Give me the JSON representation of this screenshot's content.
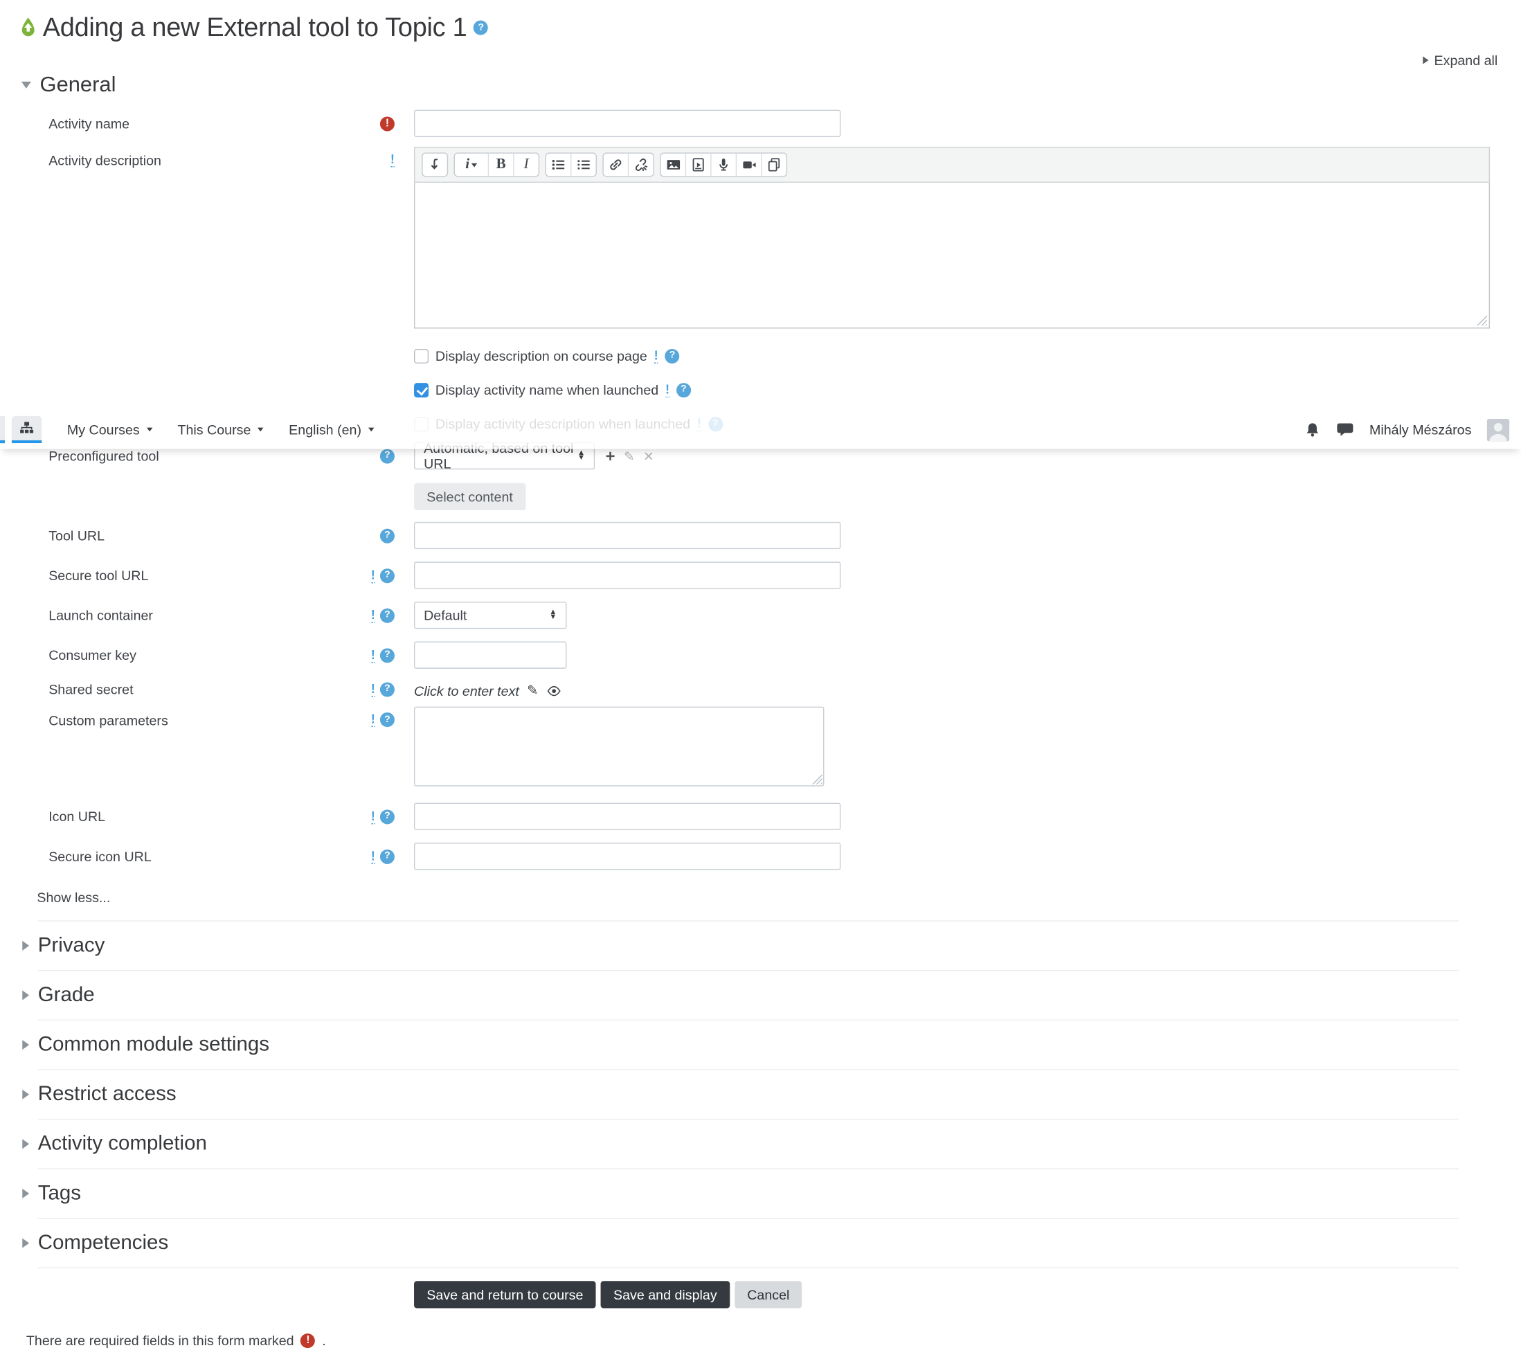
{
  "page": {
    "title": "Adding a new External tool to Topic 1",
    "expand_all": "Expand all",
    "show_less": "Show less...",
    "required_note": "There are required fields in this form marked",
    "required_note_suffix": "."
  },
  "navbar": {
    "items": [
      {
        "label": "My Courses"
      },
      {
        "label": "This Course"
      },
      {
        "label": "English (en)"
      }
    ],
    "user": {
      "name": "Mihály Mészáros"
    },
    "icons": [
      "sitemap-icon",
      "bell-icon",
      "chat-icon",
      "avatar"
    ]
  },
  "sections": {
    "general": "General",
    "collapsed": [
      {
        "label": "Privacy"
      },
      {
        "label": "Grade"
      },
      {
        "label": "Common module settings"
      },
      {
        "label": "Restrict access"
      },
      {
        "label": "Activity completion"
      },
      {
        "label": "Tags"
      },
      {
        "label": "Competencies"
      }
    ]
  },
  "fields": {
    "activity_name": {
      "label": "Activity name",
      "value": "",
      "required": true
    },
    "activity_description": {
      "label": "Activity description",
      "value": ""
    },
    "display_description": {
      "label": "Display description on course page",
      "checked": false
    },
    "display_name_launch": {
      "label": "Display activity name when launched",
      "checked": true
    },
    "display_desc_launch": {
      "label": "Display activity description when launched",
      "checked": false
    },
    "preconfigured_tool": {
      "label": "Preconfigured tool",
      "value": "Automatic, based on tool URL"
    },
    "select_content": {
      "label": "Select content"
    },
    "tool_url": {
      "label": "Tool URL",
      "value": ""
    },
    "secure_tool_url": {
      "label": "Secure tool URL",
      "value": ""
    },
    "launch_container": {
      "label": "Launch container",
      "value": "Default"
    },
    "consumer_key": {
      "label": "Consumer key",
      "value": ""
    },
    "shared_secret": {
      "label": "Shared secret",
      "placeholder": "Click to enter text"
    },
    "custom_parameters": {
      "label": "Custom parameters",
      "value": ""
    },
    "icon_url": {
      "label": "Icon URL",
      "value": ""
    },
    "secure_icon_url": {
      "label": "Secure icon URL",
      "value": ""
    }
  },
  "editor_toolbar": {
    "icons": [
      "collapse-toolbar-icon",
      "paragraph-styles-icon",
      "bold-icon",
      "italic-icon",
      "unordered-list-icon",
      "ordered-list-icon",
      "link-icon",
      "unlink-icon",
      "image-icon",
      "media-icon",
      "record-audio-icon",
      "record-video-icon",
      "manage-files-icon"
    ],
    "styles_label": "i",
    "bold_label": "B",
    "italic_label": "I"
  },
  "buttons": {
    "save_return": "Save and return to course",
    "save_display": "Save and display",
    "cancel": "Cancel"
  },
  "colors": {
    "accent_blue": "#2596e8",
    "checkbox_blue": "#3291e3",
    "help_blue": "#57a7da",
    "required_red": "#c0392b",
    "button_dark": "#343a40",
    "tool_icon_green": "#7eb43b"
  }
}
